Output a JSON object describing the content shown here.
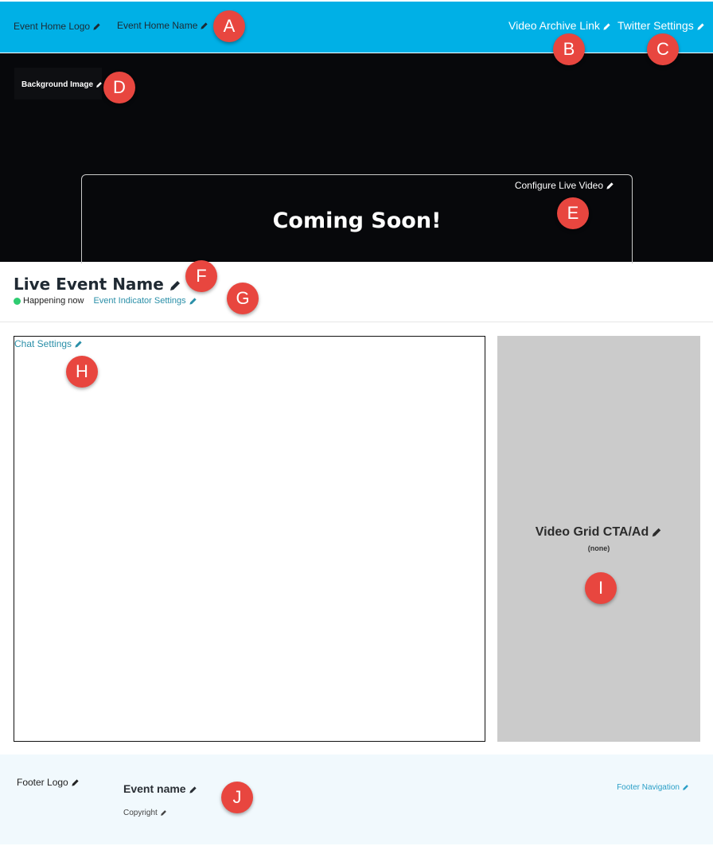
{
  "header": {
    "logo_label": "Event Home Logo",
    "name_label": "Event Home Name",
    "video_archive_label": "Video Archive Link",
    "twitter_label": "Twitter Settings",
    "background_color": "#00b0e6"
  },
  "hero": {
    "background_label": "Background Image",
    "configure_live_label": "Configure Live Video",
    "coming_soon": "Coming Soon!"
  },
  "event_info": {
    "title": "Live Event Name",
    "status": "Happening now",
    "indicator_link": "Event Indicator Settings",
    "status_color": "#2ecc71"
  },
  "chat": {
    "settings_label": "Chat Settings"
  },
  "cta": {
    "title": "Video Grid CTA/Ad",
    "subtitle": "(none)"
  },
  "footer": {
    "logo_label": "Footer Logo",
    "event_name": "Event name",
    "copyright": "Copyright",
    "navigation": "Footer Navigation"
  },
  "markers": [
    "A",
    "B",
    "C",
    "D",
    "E",
    "F",
    "G",
    "H",
    "I",
    "J"
  ],
  "colors": {
    "marker": "#e8463f",
    "link": "#2a8fa8"
  },
  "icons": {
    "edit": "pencil-icon"
  }
}
